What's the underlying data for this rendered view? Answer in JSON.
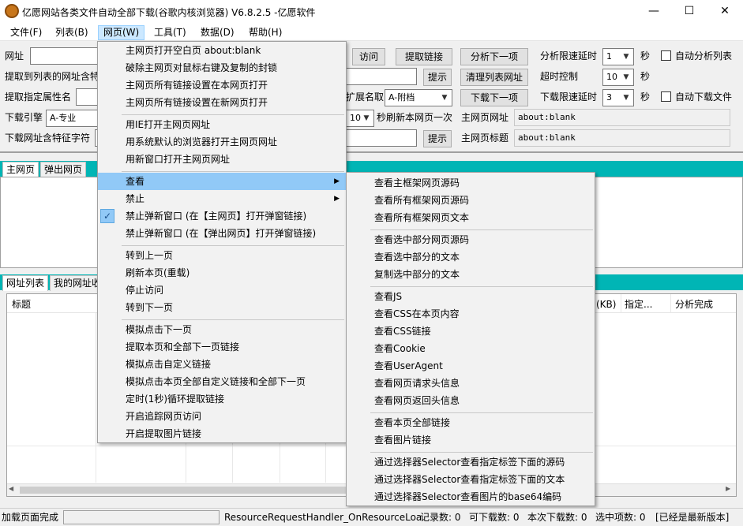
{
  "window": {
    "title": "亿愿网站各类文件自动全部下载(谷歌内核浏览器) V6.8.2.5 -亿愿软件",
    "minimize": "—",
    "maximize": "☐",
    "close": "✕"
  },
  "menubar": [
    "文件(F)",
    "列表(B)",
    "网页(W)",
    "工具(T)",
    "数据(D)",
    "帮助(H)"
  ],
  "row1": {
    "url_label": "网址",
    "visit": "访问",
    "extract_links": "提取链接",
    "analyze_next": "分析下一项",
    "delay_label": "分析限速延时",
    "delay_value": "1",
    "sec": "秒",
    "auto_analyze": "自动分析列表"
  },
  "row2": {
    "label": "提取到列表的网址含特",
    "hint": "提示",
    "clear_list": "清理列表网址",
    "timeout_label": "超时控制",
    "timeout_value": "10",
    "sec": "秒"
  },
  "row3": {
    "label": "提取指定属性名",
    "ext_label": "扩展名取",
    "ext_value": "A-附档",
    "download_next": "下载下一项",
    "dl_delay_label": "下载限速延时",
    "dl_delay_value": "3",
    "sec": "秒",
    "auto_download": "自动下载文件"
  },
  "row4": {
    "engine_label": "下载引擎",
    "engine_value": "A-专业",
    "refresh_value": "10",
    "refresh_label": "秒刷新本网页一次",
    "main_url_label": "主网页网址",
    "main_url_value": "about:blank"
  },
  "row5": {
    "label": "下载网址含特征字符",
    "hint": "提示",
    "main_title_label": "主网页标题",
    "main_title_value": "about:blank"
  },
  "tabs_top": [
    "主网页",
    "弹出网页"
  ],
  "tabs_bottom": [
    "网址列表",
    "我的网址收"
  ],
  "table": {
    "headers": [
      "标题",
      "(KB)",
      "指定...",
      "分析完成"
    ]
  },
  "menu": {
    "items": [
      "主网页打开空白页 about:blank",
      "破除主网页对鼠标右键及复制的封锁",
      "主网页所有链接设置在本网页打开",
      "主网页所有链接设置在新网页打开",
      "用IE打开主网页网址",
      "用系统默认的浏览器打开主网页网址",
      "用新窗口打开主网页网址",
      "查看",
      "禁止",
      "禁止弹新窗口 (在【主网页】打开弹窗链接)",
      "禁止弹新窗口 (在【弹出网页】打开弹窗链接)",
      "转到上一页",
      "刷新本页(重载)",
      "停止访问",
      "转到下一页",
      "模拟点击下一页",
      "提取本页和全部下一页链接",
      "模拟点击自定义链接",
      "模拟点击本页全部自定义链接和全部下一页",
      "定时(1秒)循环提取链接",
      "开启追踪网页访问",
      "开启提取图片链接"
    ]
  },
  "submenu": {
    "items": [
      "查看主框架网页源码",
      "查看所有框架网页源码",
      "查看所有框架网页文本",
      "查看选中部分网页源码",
      "查看选中部分的文本",
      "复制选中部分的文本",
      "查看JS",
      "查看CSS在本页内容",
      "查看CSS链接",
      "查看Cookie",
      "查看UserAgent",
      "查看网页请求头信息",
      "查看网页返回头信息",
      "查看本页全部链接",
      "查看图片链接",
      "通过选择器Selector查看指定标签下面的源码",
      "通过选择器Selector查看指定标签下面的文本",
      "通过选择器Selector查看图片的base64编码"
    ]
  },
  "status": {
    "left": "加载页面完成",
    "handler": "ResourceRequestHandler_OnResourceLoa",
    "record": "记录数: 0",
    "downloadable": "可下载数: 0",
    "this_dl": "本次下载数: 0",
    "selected": "选中项数: 0",
    "latest": "[已经是最新版本]"
  },
  "colors": {
    "teal": "#00b5b5",
    "menu_highlight": "#91c9f7",
    "menubar_active": "#cce8ff"
  }
}
